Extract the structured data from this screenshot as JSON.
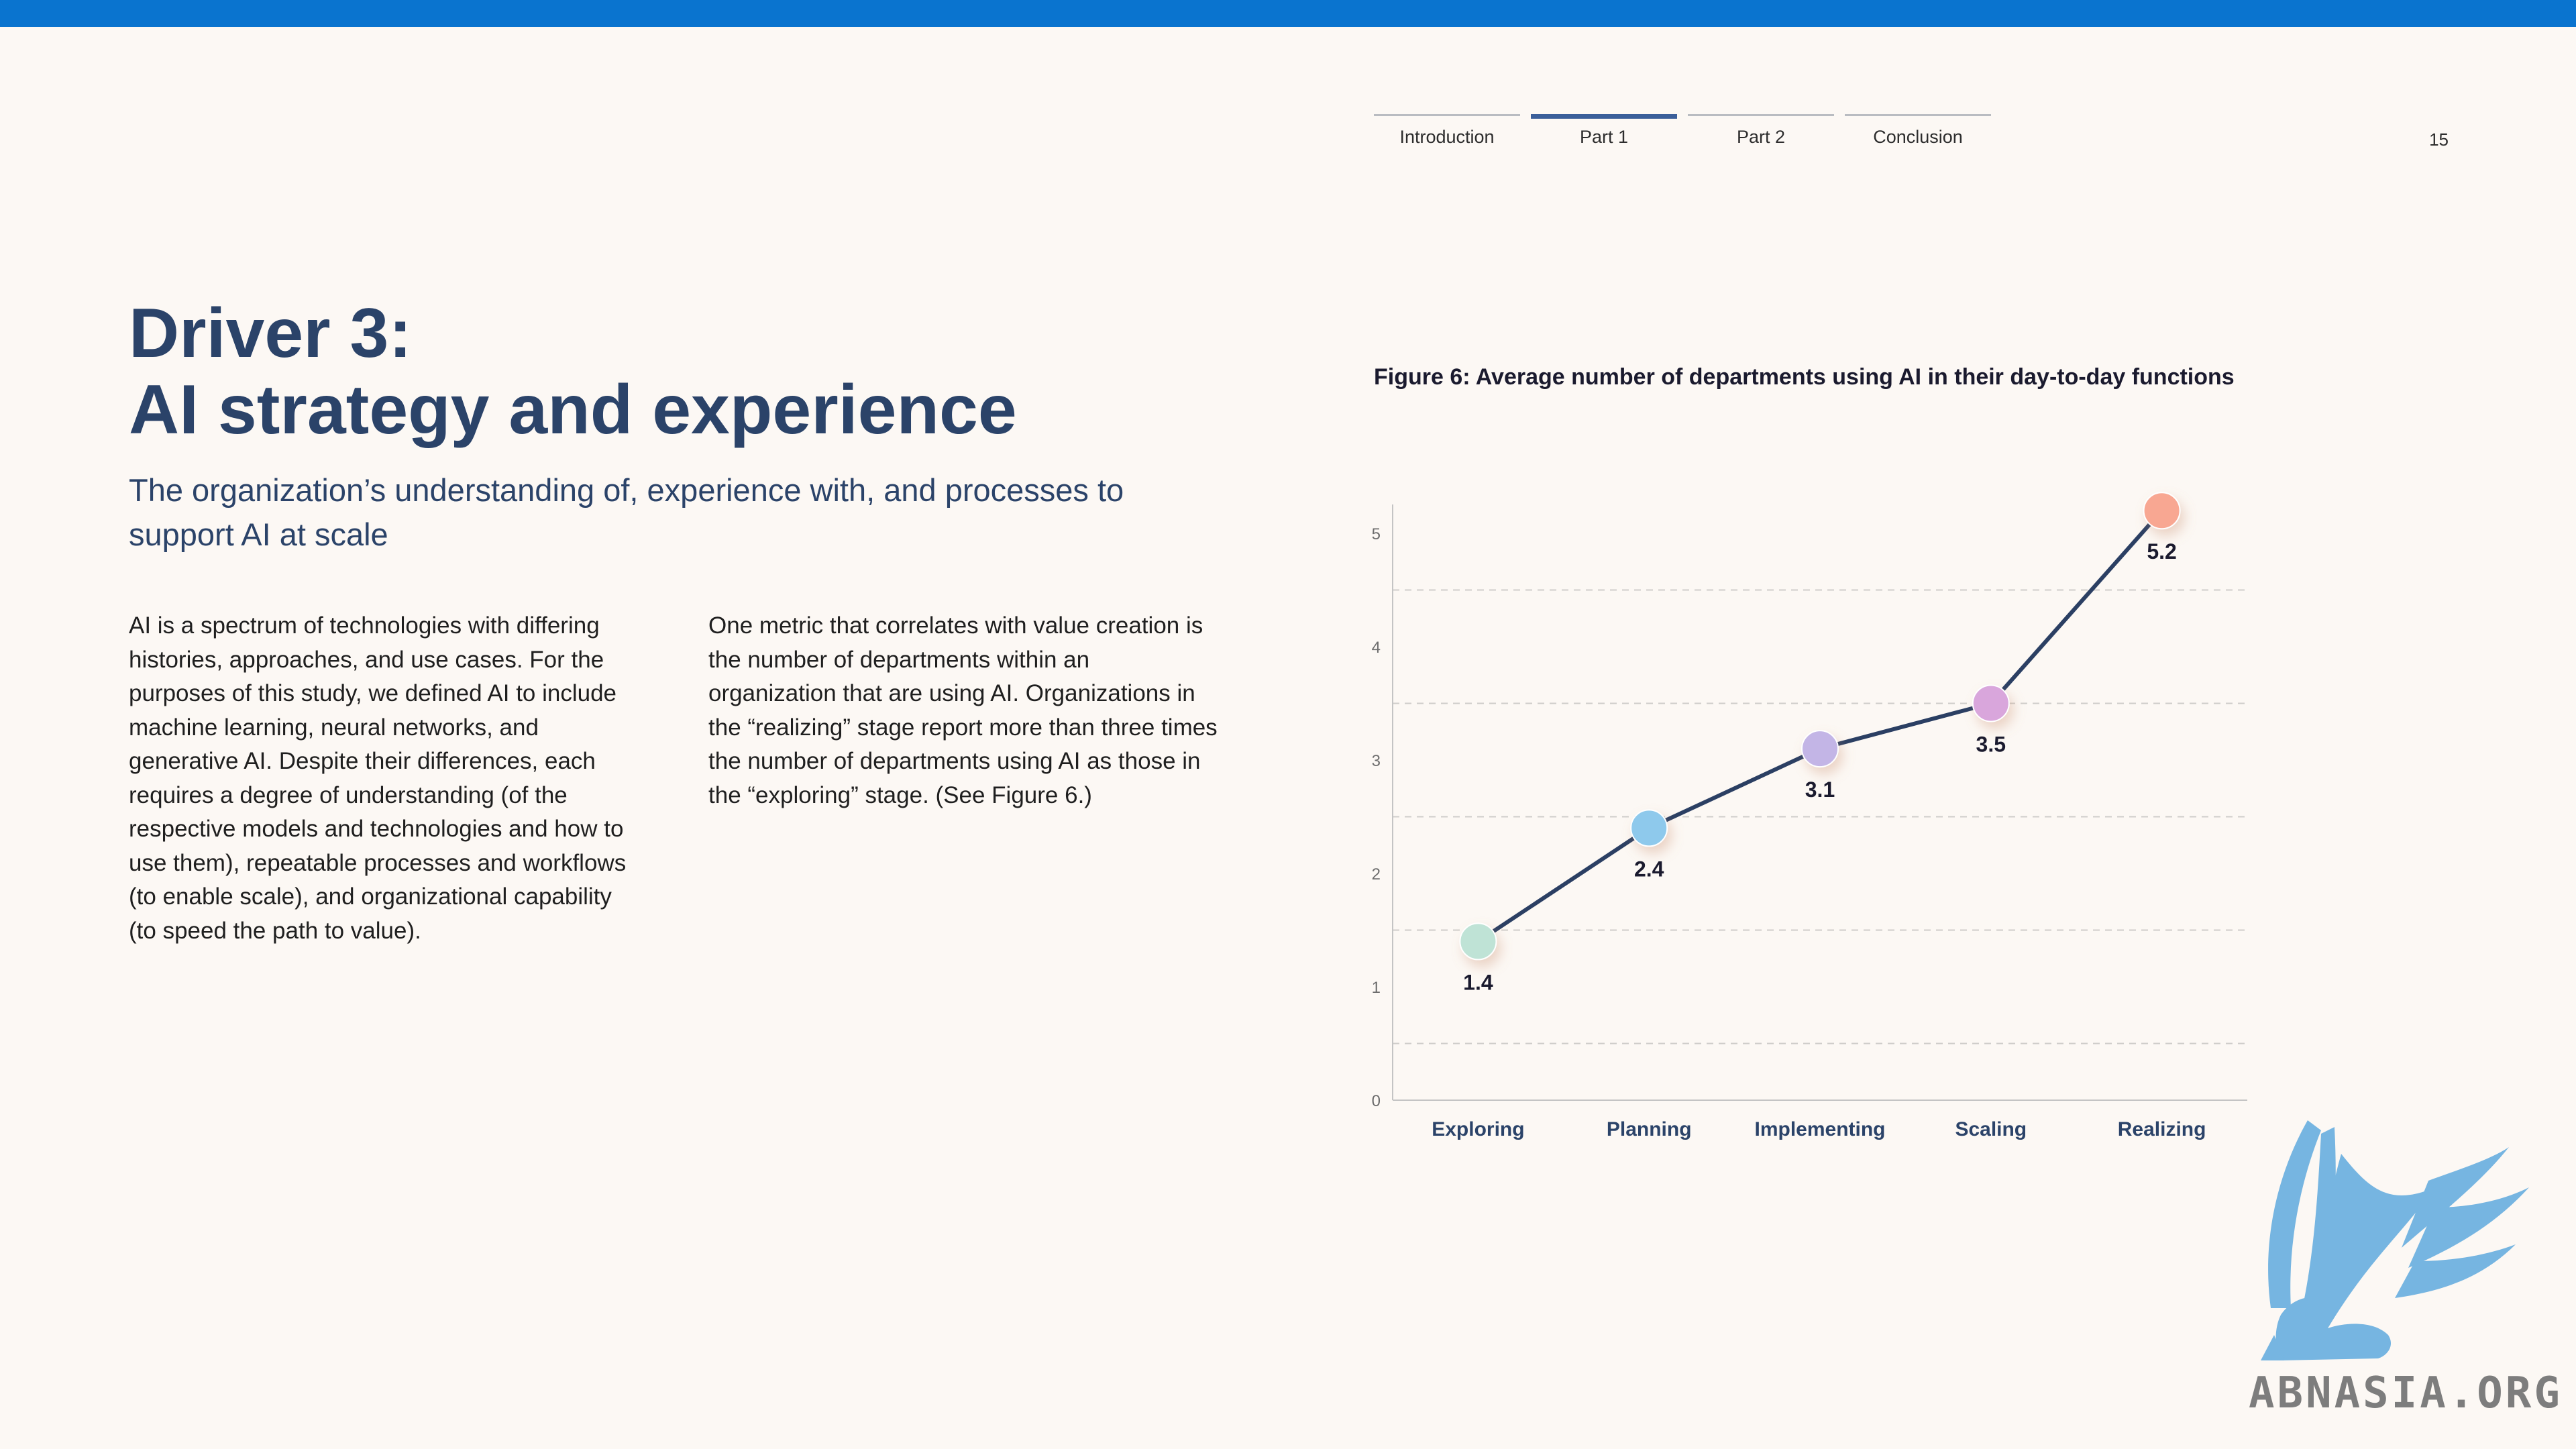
{
  "nav": {
    "tabs": [
      {
        "label": "Introduction",
        "active": false
      },
      {
        "label": "Part 1",
        "active": true
      },
      {
        "label": "Part 2",
        "active": false
      },
      {
        "label": "Conclusion",
        "active": false
      }
    ],
    "page_number": "15"
  },
  "header": {
    "title_line1": "Driver 3:",
    "title_line2": "AI strategy and experience",
    "subtitle": "The organization’s understanding of, experience with, and processes to support AI at scale"
  },
  "body": {
    "col1": "AI is a spectrum of technologies with differing histories, approaches, and use cases. For the purposes of this study, we defined AI to include machine learning, neural networks, and generative AI. Despite their differences, each requires a degree of understanding (of the respective models and technologies and how to use them), repeatable processes and workflows (to enable scale), and organizational capability (to speed the path to value).",
    "col2": "One metric that correlates with value creation is the number of departments within an organization that are using AI. Organizations in the “realizing” stage report more than three times the number of departments using AI as those in the “exploring” stage. (See Figure 6.)"
  },
  "figure": {
    "title": "Figure 6: Average number of departments using AI in their day-to-day functions"
  },
  "chart_data": {
    "type": "line",
    "title": "Figure 6: Average number of departments using AI in their day-to-day functions",
    "categories": [
      "Exploring",
      "Planning",
      "Implementing",
      "Scaling",
      "Realizing"
    ],
    "values": [
      1.4,
      2.4,
      3.1,
      3.5,
      5.2
    ],
    "data_labels": [
      "1.4",
      "2.4",
      "3.1",
      "3.5",
      "5.2"
    ],
    "point_colors": [
      "#bfe3d6",
      "#8ec9ec",
      "#c3b5e6",
      "#d9a6dc",
      "#f8a792"
    ],
    "line_color": "#2b3f63",
    "yticks": [
      0,
      1,
      2,
      3,
      4,
      5
    ],
    "ylim": [
      0,
      5.3
    ],
    "xlabel": "",
    "ylabel": "",
    "grid": true,
    "legend": "none"
  },
  "watermark": {
    "text": "ABNASIA.ORG",
    "logo_icon": "griffin-logo-icon"
  }
}
